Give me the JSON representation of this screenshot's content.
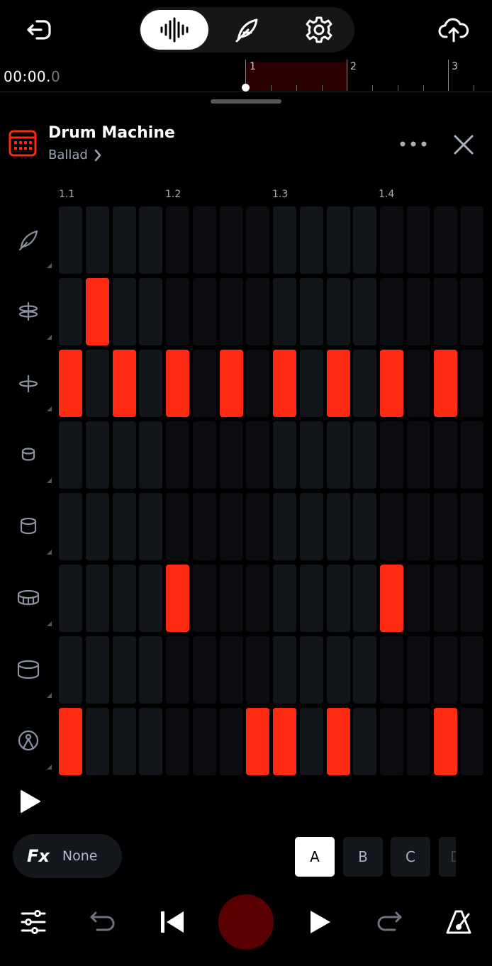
{
  "colors": {
    "accent": "#ff2a12",
    "cell_off": "#0b0d10",
    "cell_off_lit": "#121519",
    "record": "#5a0000",
    "loop_region": "#2a0000"
  },
  "top_bar": {
    "back_icon": "back-arrow-icon",
    "modes": [
      {
        "icon": "waveform-icon",
        "active": true
      },
      {
        "icon": "feather-icon",
        "active": false
      },
      {
        "icon": "gear-icon",
        "active": false
      }
    ],
    "upload_icon": "cloud-upload-icon"
  },
  "timeline": {
    "time_main": "00:00.",
    "time_fraction": "0",
    "bar_numbers": [
      "1",
      "2",
      "3"
    ]
  },
  "instrument": {
    "title": "Drum Machine",
    "preset": "Ballad",
    "icon": "drum-machine-icon"
  },
  "sequencer": {
    "beat_labels": [
      "1.1",
      "1.2",
      "1.3",
      "1.4"
    ],
    "rows": [
      {
        "icon": "shaker-icon",
        "steps": [
          0,
          0,
          0,
          0,
          0,
          0,
          0,
          0,
          0,
          0,
          0,
          0,
          0,
          0,
          0,
          0
        ]
      },
      {
        "icon": "open-hihat-icon",
        "steps": [
          0,
          1,
          0,
          0,
          0,
          0,
          0,
          0,
          0,
          0,
          0,
          0,
          0,
          0,
          0,
          0
        ]
      },
      {
        "icon": "closed-hihat-icon",
        "steps": [
          1,
          0,
          1,
          0,
          1,
          0,
          1,
          0,
          1,
          0,
          1,
          0,
          1,
          0,
          1,
          0
        ]
      },
      {
        "icon": "high-tom-icon",
        "steps": [
          0,
          0,
          0,
          0,
          0,
          0,
          0,
          0,
          0,
          0,
          0,
          0,
          0,
          0,
          0,
          0
        ]
      },
      {
        "icon": "mid-tom-icon",
        "steps": [
          0,
          0,
          0,
          0,
          0,
          0,
          0,
          0,
          0,
          0,
          0,
          0,
          0,
          0,
          0,
          0
        ]
      },
      {
        "icon": "snare-icon",
        "steps": [
          0,
          0,
          0,
          0,
          1,
          0,
          0,
          0,
          0,
          0,
          0,
          0,
          1,
          0,
          0,
          0
        ]
      },
      {
        "icon": "floor-tom-icon",
        "steps": [
          0,
          0,
          0,
          0,
          0,
          0,
          0,
          0,
          0,
          0,
          0,
          0,
          0,
          0,
          0,
          0
        ]
      },
      {
        "icon": "kick-drum-icon",
        "steps": [
          1,
          0,
          0,
          0,
          0,
          0,
          0,
          1,
          1,
          0,
          1,
          0,
          0,
          0,
          1,
          0
        ]
      }
    ]
  },
  "fx": {
    "label": "Fx",
    "value": "None"
  },
  "patterns": [
    {
      "label": "A",
      "active": true
    },
    {
      "label": "B",
      "active": false
    },
    {
      "label": "C",
      "active": false
    },
    {
      "label": "D",
      "active": false
    }
  ],
  "bottom_bar": {
    "icons": [
      "mixer-sliders-icon",
      "undo-icon",
      "skip-back-icon",
      "record-icon",
      "play-icon",
      "redo-icon",
      "metronome-icon"
    ]
  }
}
